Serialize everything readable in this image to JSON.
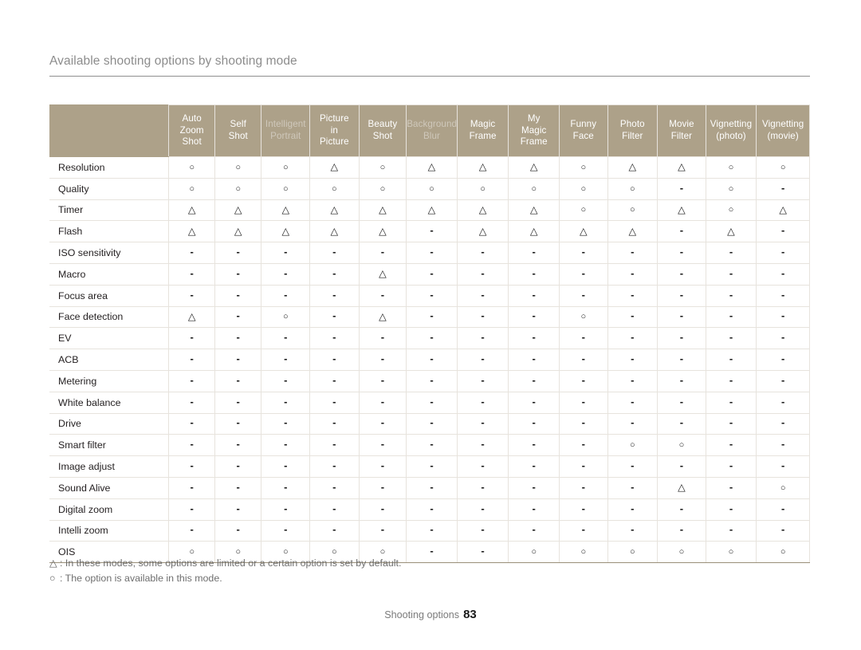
{
  "heading": "Available shooting options by shooting mode",
  "colors": {
    "header_band": "#ada189",
    "rule": "#8f8f8f",
    "grid": "#e7e3dd",
    "text": "#231f20",
    "muted": "#8c8c8c"
  },
  "table": {
    "corner_label": "",
    "columns": [
      {
        "id": "auto-zoom-shot",
        "lines": [
          "Auto",
          "Zoom",
          "Shot"
        ],
        "dim": false
      },
      {
        "id": "self-shot",
        "lines": [
          "Self",
          "Shot"
        ],
        "dim": false
      },
      {
        "id": "intelligent-portrait",
        "lines": [
          "Intelligent",
          "Portrait"
        ],
        "dim": true
      },
      {
        "id": "picture-in-picture",
        "lines": [
          "Picture",
          "in",
          "Picture"
        ],
        "dim": false
      },
      {
        "id": "beauty-shot",
        "lines": [
          "Beauty",
          "Shot"
        ],
        "dim": false
      },
      {
        "id": "background-blur",
        "lines": [
          "Background",
          "Blur"
        ],
        "dim": true
      },
      {
        "id": "magic-frame",
        "lines": [
          "Magic",
          "Frame"
        ],
        "dim": false
      },
      {
        "id": "my-magic-frame",
        "lines": [
          "My",
          "Magic",
          "Frame"
        ],
        "dim": false
      },
      {
        "id": "funny-face",
        "lines": [
          "Funny",
          "Face"
        ],
        "dim": false
      },
      {
        "id": "photo-filter",
        "lines": [
          "Photo",
          "Filter"
        ],
        "dim": false
      },
      {
        "id": "movie-filter",
        "lines": [
          "Movie",
          "Filter"
        ],
        "dim": false
      },
      {
        "id": "vignetting-photo",
        "lines": [
          "Vignetting",
          "(photo)"
        ],
        "dim": false
      },
      {
        "id": "vignetting-movie",
        "lines": [
          "Vignetting",
          "(movie)"
        ],
        "dim": false
      }
    ],
    "rows": [
      {
        "label": "Resolution",
        "cells": [
          "circle",
          "circle",
          "circle",
          "tri",
          "circle",
          "tri",
          "tri",
          "tri",
          "circle",
          "tri",
          "tri",
          "circle",
          "circle"
        ]
      },
      {
        "label": "Quality",
        "cells": [
          "circle",
          "circle",
          "circle",
          "circle",
          "circle",
          "circle",
          "circle",
          "circle",
          "circle",
          "circle",
          "dash",
          "circle",
          "dash"
        ]
      },
      {
        "label": "Timer",
        "cells": [
          "tri",
          "tri",
          "tri",
          "tri",
          "tri",
          "tri",
          "tri",
          "tri",
          "circle",
          "circle",
          "tri",
          "circle",
          "tri"
        ]
      },
      {
        "label": "Flash",
        "cells": [
          "tri",
          "tri",
          "tri",
          "tri",
          "tri",
          "dash",
          "tri",
          "tri",
          "tri",
          "tri",
          "dash",
          "tri",
          "dash"
        ]
      },
      {
        "label": "ISO sensitivity",
        "cells": [
          "dash",
          "dash",
          "dash",
          "dash",
          "dash",
          "dash",
          "dash",
          "dash",
          "dash",
          "dash",
          "dash",
          "dash",
          "dash"
        ]
      },
      {
        "label": "Macro",
        "cells": [
          "dash",
          "dash",
          "dash",
          "dash",
          "tri",
          "dash",
          "dash",
          "dash",
          "dash",
          "dash",
          "dash",
          "dash",
          "dash"
        ]
      },
      {
        "label": "Focus area",
        "cells": [
          "dash",
          "dash",
          "dash",
          "dash",
          "dash",
          "dash",
          "dash",
          "dash",
          "dash",
          "dash",
          "dash",
          "dash",
          "dash"
        ]
      },
      {
        "label": "Face detection",
        "cells": [
          "tri",
          "dash",
          "circle",
          "dash",
          "tri",
          "dash",
          "dash",
          "dash",
          "circle",
          "dash",
          "dash",
          "dash",
          "dash"
        ]
      },
      {
        "label": "EV",
        "cells": [
          "dash",
          "dash",
          "dash",
          "dash",
          "dash",
          "dash",
          "dash",
          "dash",
          "dash",
          "dash",
          "dash",
          "dash",
          "dash"
        ]
      },
      {
        "label": "ACB",
        "cells": [
          "dash",
          "dash",
          "dash",
          "dash",
          "dash",
          "dash",
          "dash",
          "dash",
          "dash",
          "dash",
          "dash",
          "dash",
          "dash"
        ]
      },
      {
        "label": "Metering",
        "cells": [
          "dash",
          "dash",
          "dash",
          "dash",
          "dash",
          "dash",
          "dash",
          "dash",
          "dash",
          "dash",
          "dash",
          "dash",
          "dash"
        ]
      },
      {
        "label": "White balance",
        "cells": [
          "dash",
          "dash",
          "dash",
          "dash",
          "dash",
          "dash",
          "dash",
          "dash",
          "dash",
          "dash",
          "dash",
          "dash",
          "dash"
        ]
      },
      {
        "label": "Drive",
        "cells": [
          "dash",
          "dash",
          "dash",
          "dash",
          "dash",
          "dash",
          "dash",
          "dash",
          "dash",
          "dash",
          "dash",
          "dash",
          "dash"
        ]
      },
      {
        "label": "Smart filter",
        "cells": [
          "dash",
          "dash",
          "dash",
          "dash",
          "dash",
          "dash",
          "dash",
          "dash",
          "dash",
          "circle",
          "circle",
          "dash",
          "dash"
        ]
      },
      {
        "label": "Image adjust",
        "cells": [
          "dash",
          "dash",
          "dash",
          "dash",
          "dash",
          "dash",
          "dash",
          "dash",
          "dash",
          "dash",
          "dash",
          "dash",
          "dash"
        ]
      },
      {
        "label": "Sound Alive",
        "cells": [
          "dash",
          "dash",
          "dash",
          "dash",
          "dash",
          "dash",
          "dash",
          "dash",
          "dash",
          "dash",
          "tri",
          "dash",
          "circle"
        ]
      },
      {
        "label": "Digital zoom",
        "cells": [
          "dash",
          "dash",
          "dash",
          "dash",
          "dash",
          "dash",
          "dash",
          "dash",
          "dash",
          "dash",
          "dash",
          "dash",
          "dash"
        ]
      },
      {
        "label": "Intelli zoom",
        "cells": [
          "dash",
          "dash",
          "dash",
          "dash",
          "dash",
          "dash",
          "dash",
          "dash",
          "dash",
          "dash",
          "dash",
          "dash",
          "dash"
        ]
      },
      {
        "label": "OIS",
        "cells": [
          "circle",
          "circle",
          "circle",
          "circle",
          "circle",
          "dash",
          "dash",
          "circle",
          "circle",
          "circle",
          "circle",
          "circle",
          "circle"
        ]
      }
    ]
  },
  "legend": [
    {
      "symbol": "tri",
      "text": ": In these modes, some options are limited or a certain option is set by default."
    },
    {
      "symbol": "circle",
      "text": ": The option is available in this mode."
    }
  ],
  "footer": {
    "label": "Shooting options",
    "page_number": "83"
  }
}
